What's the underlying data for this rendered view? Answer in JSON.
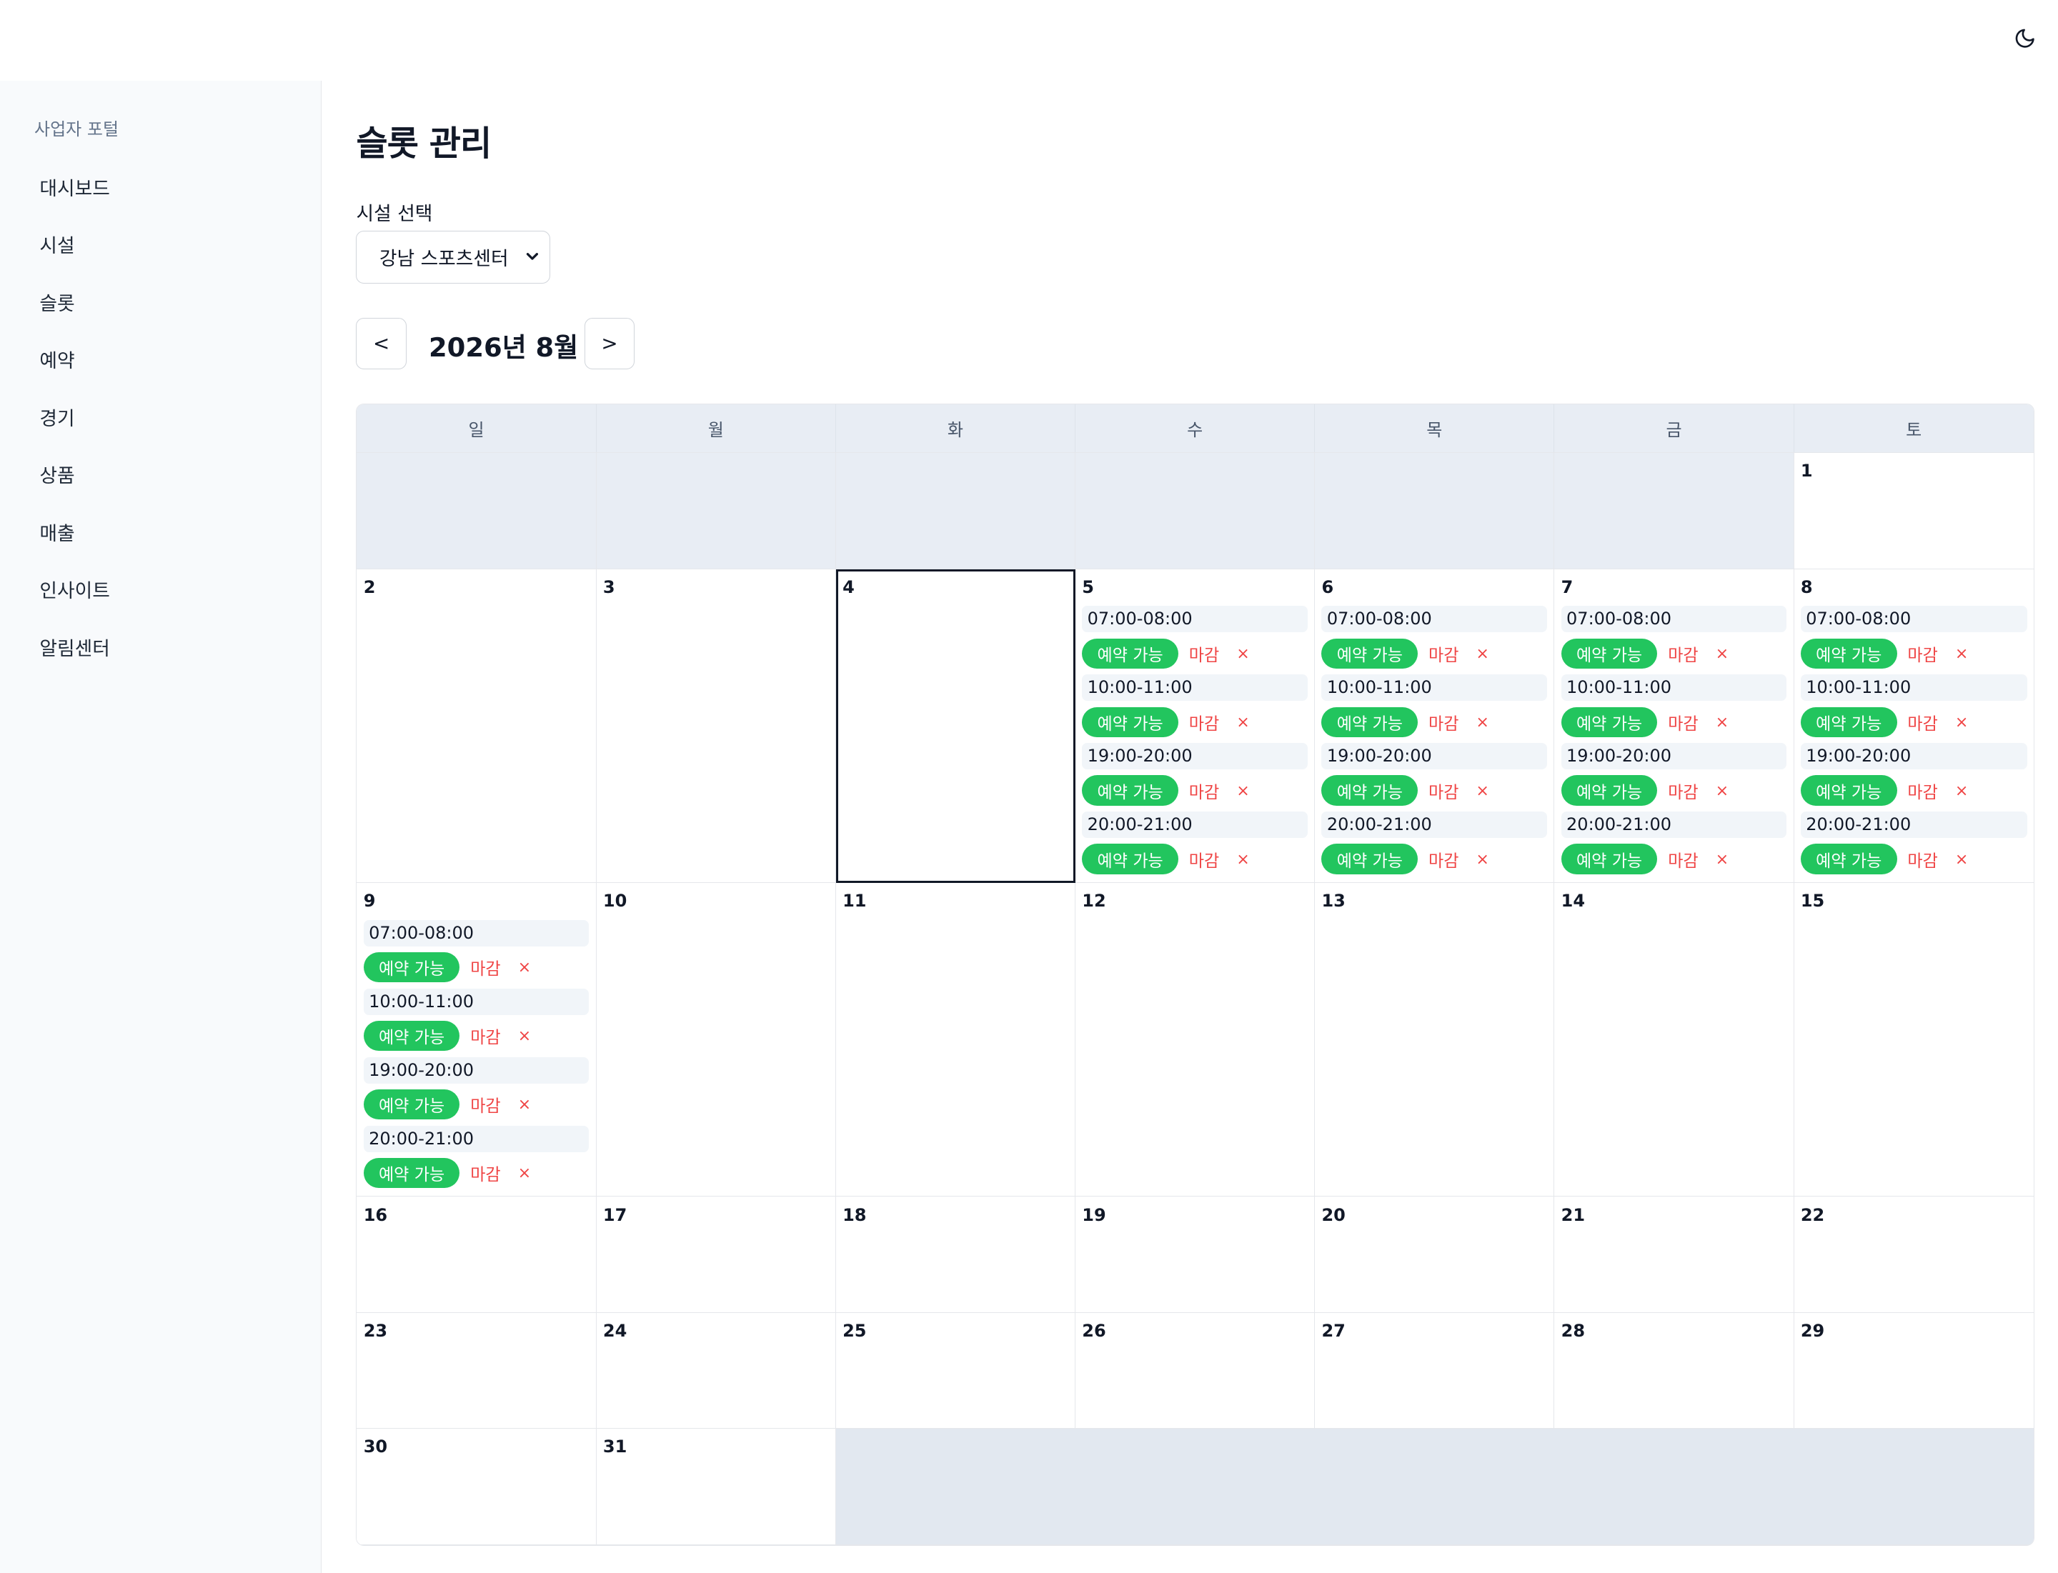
{
  "header": {
    "theme_toggle_icon": "moon-icon"
  },
  "sidebar": {
    "title": "사업자 포털",
    "items": [
      {
        "label": "대시보드"
      },
      {
        "label": "시설"
      },
      {
        "label": "슬롯"
      },
      {
        "label": "예약"
      },
      {
        "label": "경기"
      },
      {
        "label": "상품"
      },
      {
        "label": "매출"
      },
      {
        "label": "인사이트"
      },
      {
        "label": "알림센터"
      }
    ]
  },
  "main": {
    "title": "슬롯 관리",
    "facility_label": "시설 선택",
    "facility_selected": "강남 스포츠센터",
    "prev_label": "<",
    "next_label": ">",
    "month_label": "2026년 8월"
  },
  "calendar": {
    "weekdays": [
      "일",
      "월",
      "화",
      "수",
      "목",
      "금",
      "토"
    ],
    "leading_empty": 6,
    "days_in_month": 31,
    "today": 4,
    "slot_texts": {
      "available": "예약 가능",
      "closed": "마감",
      "delete": "×"
    },
    "slots": {
      "5": [
        "07:00-08:00",
        "10:00-11:00",
        "19:00-20:00",
        "20:00-21:00"
      ],
      "6": [
        "07:00-08:00",
        "10:00-11:00",
        "19:00-20:00",
        "20:00-21:00"
      ],
      "7": [
        "07:00-08:00",
        "10:00-11:00",
        "19:00-20:00",
        "20:00-21:00"
      ],
      "8": [
        "07:00-08:00",
        "10:00-11:00",
        "19:00-20:00",
        "20:00-21:00"
      ],
      "9": [
        "07:00-08:00",
        "10:00-11:00",
        "19:00-20:00",
        "20:00-21:00"
      ]
    },
    "colors": {
      "available": "#22c55e",
      "closed": "#ef4444",
      "empty_cell": "#e8edf4"
    }
  }
}
